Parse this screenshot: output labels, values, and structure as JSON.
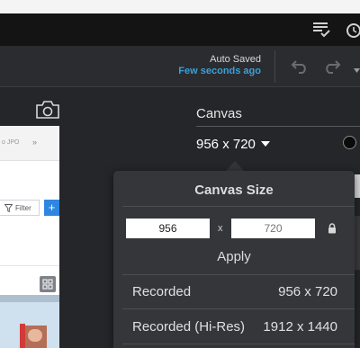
{
  "header": {
    "auto_saved_label": "Auto Saved",
    "auto_saved_time": "Few seconds ago",
    "icons": [
      "checklist-icon",
      "history-icon",
      "undo-icon",
      "redo-icon",
      "chevron-down-icon"
    ]
  },
  "preview": {
    "tab_text": "o JPO",
    "arrows": "»",
    "filter_label": "Filter",
    "plus_label": "+"
  },
  "canvas": {
    "title": "Canvas",
    "current_size": "956 x 720"
  },
  "canvas_size_popover": {
    "title": "Canvas Size",
    "width_value": "956",
    "height_placeholder": "720",
    "separator": "x",
    "apply_label": "Apply",
    "presets": [
      {
        "label": "Recorded",
        "value": "956 x 720"
      },
      {
        "label": "Recorded (Hi-Res)",
        "value": "1912 x 1440"
      }
    ]
  },
  "colors": {
    "accent_blue": "#3aa0d8",
    "panel_bg": "#252629",
    "popover_bg": "#34363a"
  }
}
